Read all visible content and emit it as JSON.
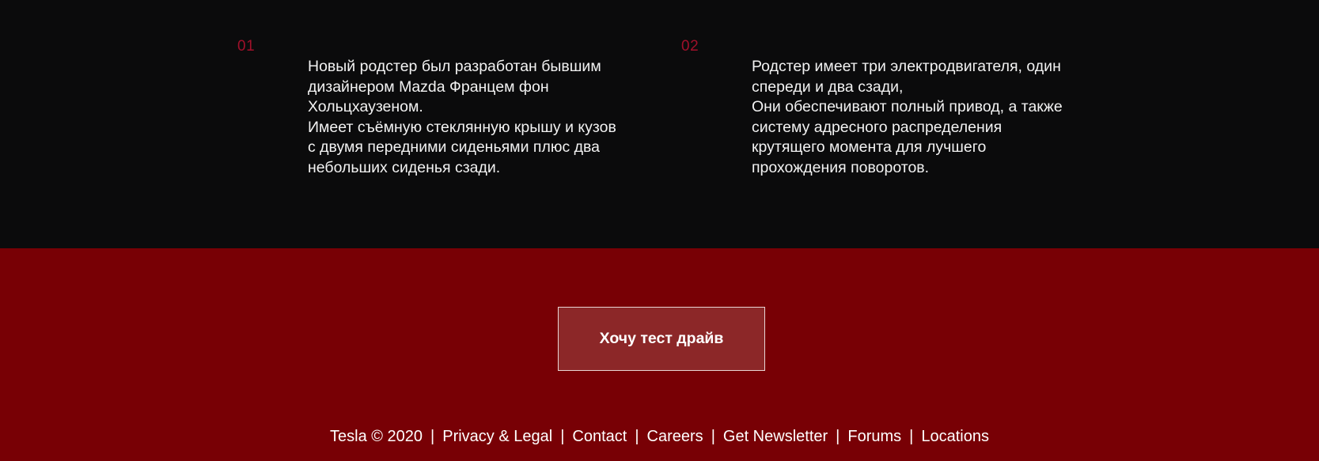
{
  "features": [
    {
      "number": "01",
      "text": "Новый родстер был разработан бывшим\nдизайнером Mazda Францем фон\nХольцхаузеном.\nИмеет съёмную стеклянную крышу и кузов\nс двумя передними сиденьями плюс два\nнебольших сиденья сзади."
    },
    {
      "number": "02",
      "text": "Родстер имеет три электродвигателя, один\nспереди и два сзади,\nОни обеспечивают полный привод, а также\nсистему адресного распределения\nкрутящего момента для лучшего\nпрохождения поворотов."
    }
  ],
  "cta": {
    "label": "Хочу тест драйв"
  },
  "footer": {
    "copyright": "Tesla © 2020",
    "separator": "|",
    "links": [
      "Privacy & Legal",
      "Contact",
      "Careers",
      "Get Newsletter",
      "Forums",
      "Locations"
    ]
  },
  "colors": {
    "dark_background": "#0b0b0c",
    "accent_red": "#a0102a",
    "cta_background": "#780005",
    "button_background": "#8c2728"
  }
}
